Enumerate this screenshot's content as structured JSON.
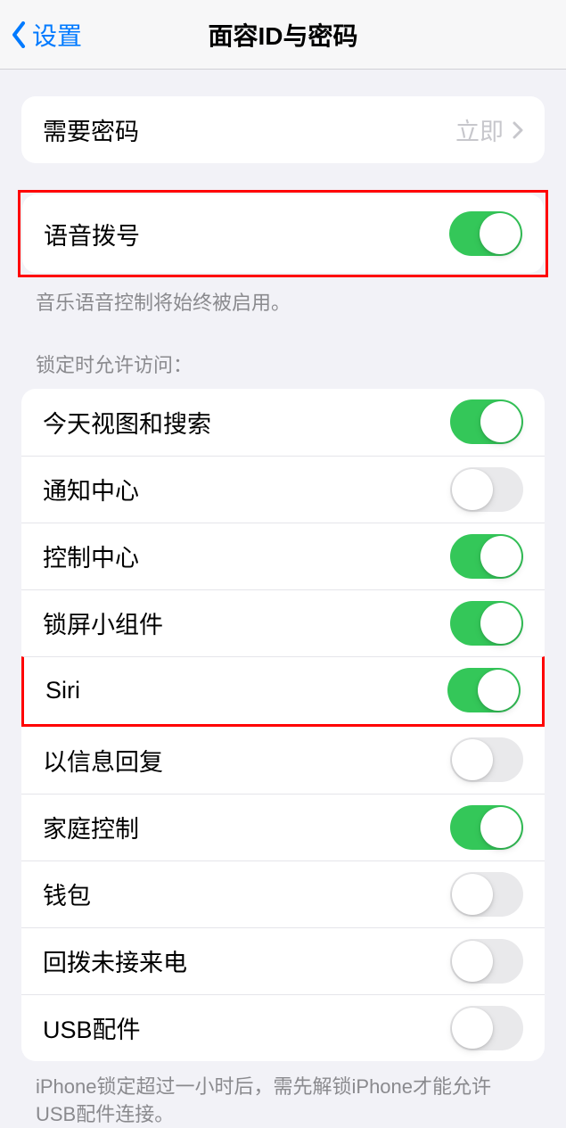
{
  "header": {
    "back_label": "设置",
    "title": "面容ID与密码"
  },
  "passcode_section": {
    "label": "需要密码",
    "value": "立即"
  },
  "voice_dial": {
    "label": "语音拨号",
    "on": true,
    "footer": "音乐语音控制将始终被启用。"
  },
  "lock_access": {
    "header": "锁定时允许访问：",
    "items": [
      {
        "label": "今天视图和搜索",
        "on": true
      },
      {
        "label": "通知中心",
        "on": false
      },
      {
        "label": "控制中心",
        "on": true
      },
      {
        "label": "锁屏小组件",
        "on": true
      },
      {
        "label": "Siri",
        "on": true
      },
      {
        "label": "以信息回复",
        "on": false
      },
      {
        "label": "家庭控制",
        "on": true
      },
      {
        "label": "钱包",
        "on": false
      },
      {
        "label": "回拨未接来电",
        "on": false
      },
      {
        "label": "USB配件",
        "on": false
      }
    ],
    "footer": "iPhone锁定超过一小时后，需先解锁iPhone才能允许USB配件连接。"
  }
}
